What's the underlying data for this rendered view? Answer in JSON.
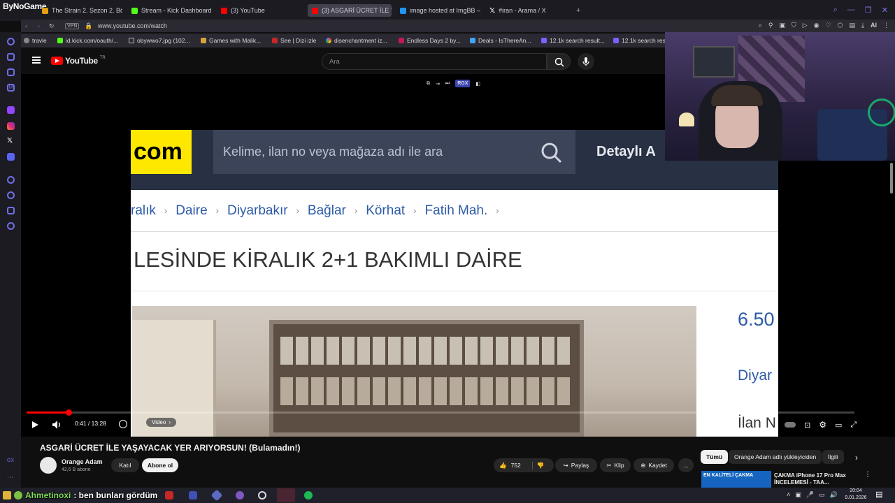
{
  "browser": {
    "brand": "ByNoGame",
    "tabs": [
      {
        "label": "The Strain 2. Sezon 2. Bölü",
        "color": "#e5a00d"
      },
      {
        "label": "Stream - Kick Dashboard",
        "color": "#53fc18"
      },
      {
        "label": "(3) YouTube",
        "color": "#ff0000"
      },
      {
        "label": "(3) ASGARİ ÜCRET İLE YA",
        "color": "#ff0000"
      },
      {
        "label": "image hosted at ImgBB —",
        "color": "#2196f3"
      },
      {
        "label": "#iran - Arama / X",
        "color": "#ffffff"
      }
    ],
    "new_tab": "+",
    "address": {
      "vpn": "VPN",
      "url": "www.youtube.com/watch"
    },
    "bookmarks": [
      "travle",
      "id.kick.com/oauth/...",
      "obywwo7.jpg (102...",
      "Games with Malik...",
      "See | Dizi izle",
      "disenchantment iz...",
      "Endless Days 2 by...",
      "Deals - IsThereAn...",
      "12.1k search result...",
      "12.1k search res"
    ]
  },
  "youtube": {
    "logo": "YouTube",
    "logo_region": "TR",
    "search_placeholder": "Ara",
    "ext_badge": "RGX",
    "video_content": {
      "domain_tail": "com",
      "site_search": "Kelime, ilan no veya mağaza adı ile ara",
      "detail_search": "Detaylı A",
      "breadcrumb": [
        "ralık",
        "Daire",
        "Diyarbakır",
        "Bağlar",
        "Körhat",
        "Fatih Mah."
      ],
      "listing_title": "LESİNDE KİRALIK 2+1 BAKIMLI DAİRE",
      "price": "6.50",
      "city": "Diyar",
      "ilan": "İlan N"
    },
    "player": {
      "time": "0:41 / 13:28",
      "chapter": "Video",
      "progress_fraction": 0.051
    },
    "video_title": "ASGARİ ÜCRET İLE YAŞAYACAK YER ARIYORSUN! (Bulamadın!)",
    "channel": {
      "name": "Orange Adam",
      "subs": "42,6 B abone",
      "join": "Katıl",
      "subscribe": "Abone ol"
    },
    "actions": {
      "likes": "752",
      "share": "Paylaş",
      "clip": "Klip",
      "save": "Kaydet",
      "more": "..."
    },
    "chips": [
      "Tümü",
      "Orange Adam adlı yükleyiciden",
      "İlgili"
    ],
    "recommended": {
      "thumb_text": "EN KALİTELİ ÇAKMA",
      "title": "ÇAKMA iPhone 17 Pro Max İNCELEMESİ - TAA..."
    }
  },
  "chat": {
    "user": "Ahmetinoxi",
    "message": ": ben bunları gördüm"
  },
  "taskbar": {
    "time": "20:04",
    "date": "9.01.2026"
  }
}
